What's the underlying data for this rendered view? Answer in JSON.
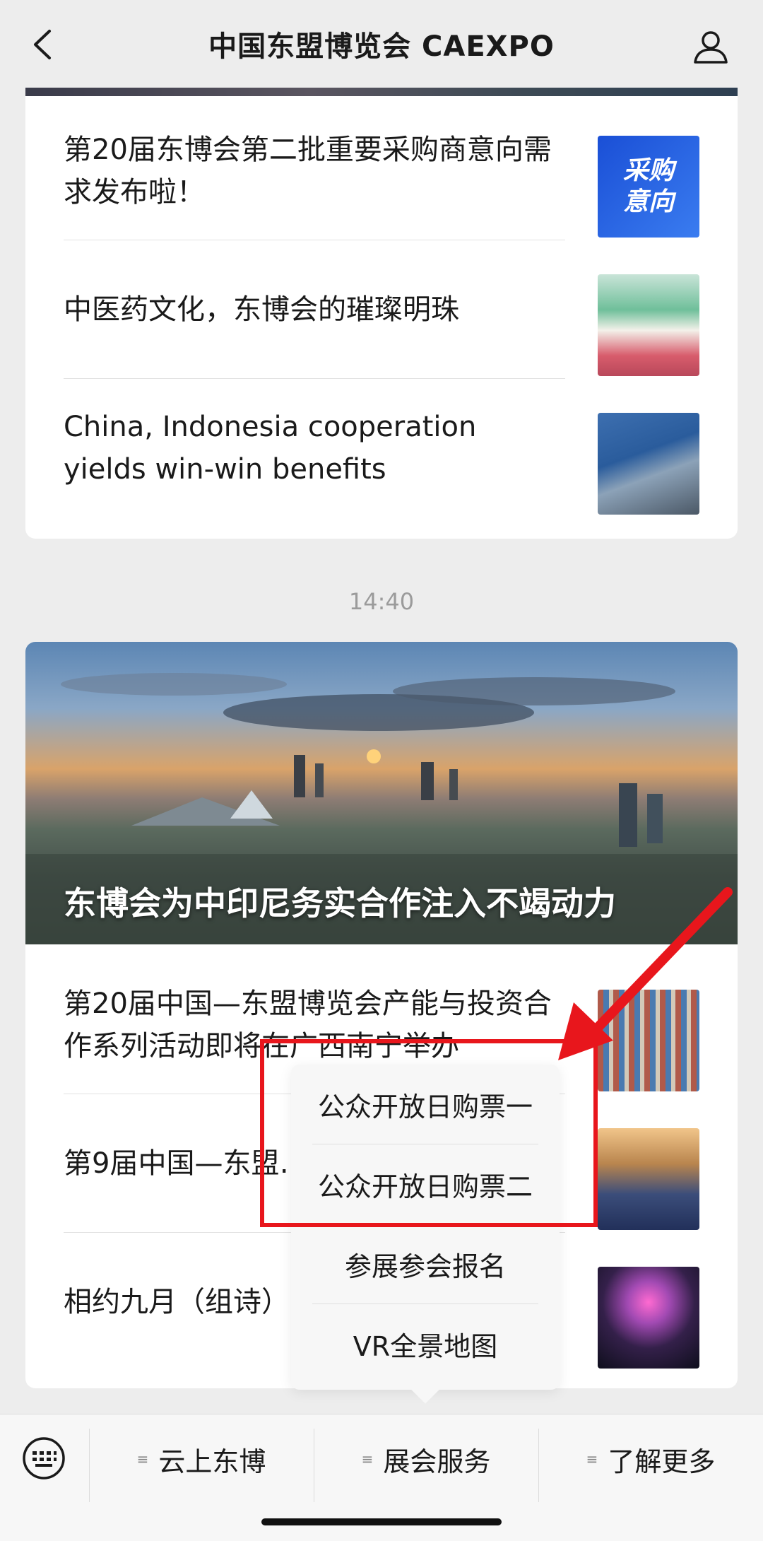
{
  "header": {
    "title": "中国东盟博览会 CAEXPO",
    "back_icon": "chevron-left-icon",
    "profile_icon": "user-icon"
  },
  "articles_group1": [
    {
      "title": "第20届东博会第二批重要采购商意向需求发布啦！",
      "thumb_text": "采购意向"
    },
    {
      "title": "中医药文化，东博会的璀璨明珠"
    },
    {
      "title": "China, Indonesia cooperation yields win-win benefits"
    }
  ],
  "timestamp": "14:40",
  "hero": {
    "title": "东博会为中印尼务实合作注入不竭动力"
  },
  "articles_group2": [
    {
      "title": "第20届中国—东盟博览会产能与投资合作系列活动即将在广西南宁举办"
    },
    {
      "title": "第9届中国—东盟…宁举办"
    },
    {
      "title": "相约九月（组诗）"
    }
  ],
  "popup_menu": {
    "items": [
      "公众开放日购票一",
      "公众开放日购票二",
      "参展参会报名",
      "VR全景地图"
    ]
  },
  "bottom_menu": {
    "keyboard_icon": "keyboard-icon",
    "items": [
      "云上东博",
      "展会服务",
      "了解更多"
    ]
  },
  "colors": {
    "annotation": "#e8161c",
    "background": "#ededed"
  }
}
